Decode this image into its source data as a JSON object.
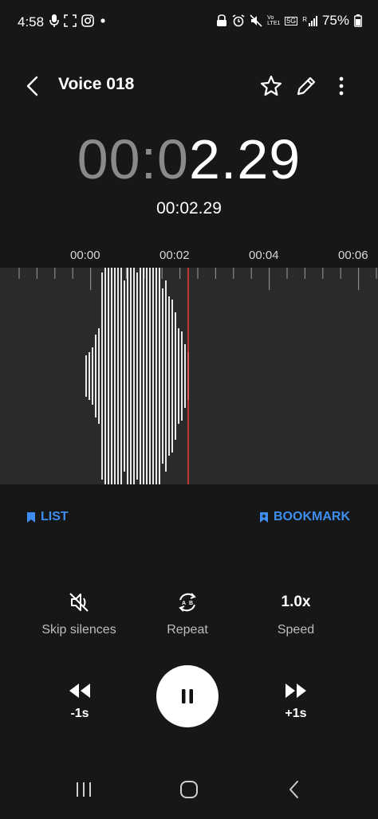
{
  "status_bar": {
    "time": "4:58",
    "battery_text": "75%",
    "left_icons": [
      "mic-icon",
      "screen-capture-icon",
      "instagram-icon",
      "dot-icon"
    ],
    "right_icons": [
      "vpn-icon",
      "alarm-icon",
      "mute-icon",
      "volte-icon",
      "5g-icon",
      "signal-icon",
      "battery-icon"
    ],
    "network_label": "5G",
    "volte_label": "Vo LTE1",
    "roaming_label": "R"
  },
  "header": {
    "title": "Voice 018"
  },
  "playback": {
    "big_time_dim": "00:0",
    "big_time_bright": "2.29",
    "small_time": "00:02.29"
  },
  "ruler": {
    "labels": [
      "00:00",
      "00:02",
      "00:04",
      "00:06"
    ]
  },
  "actions": {
    "list_label": "LIST",
    "bookmark_label": "BOOKMARK"
  },
  "options": {
    "skip_silences_label": "Skip silences",
    "repeat_label": "Repeat",
    "repeat_icon_letters": [
      "A",
      "B"
    ],
    "speed_value": "1.0x",
    "speed_label": "Speed"
  },
  "transport": {
    "rewind_label": "-1s",
    "forward_label": "+1s"
  },
  "colors": {
    "accent": "#3d8ef0",
    "playhead": "#e53935",
    "background": "#171717",
    "wave_bg": "#2a2a2a"
  }
}
